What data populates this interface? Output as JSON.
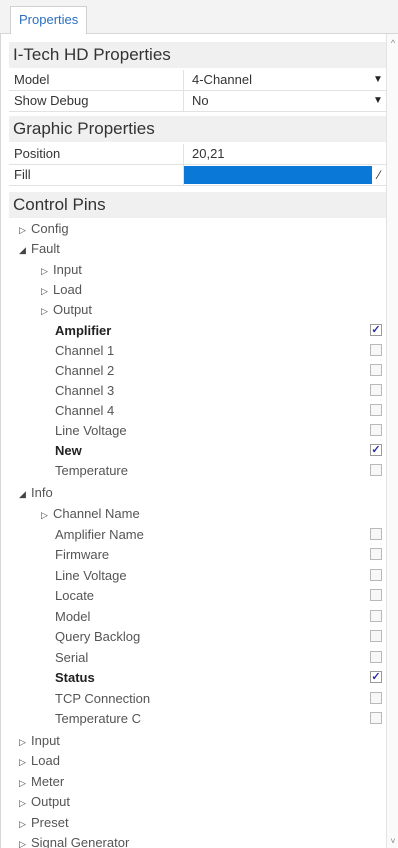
{
  "tab_label": "Properties",
  "section_ith": {
    "title": "I-Tech HD Properties"
  },
  "model_row": {
    "label": "Model",
    "value": "4-Channel"
  },
  "debug_row": {
    "label": "Show Debug",
    "value": "No"
  },
  "section_graphic": {
    "title": "Graphic Properties"
  },
  "position_row": {
    "label": "Position",
    "value": "20,21"
  },
  "fill_row": {
    "label": "Fill",
    "color": "#0a78d7"
  },
  "section_pins": {
    "title": "Control Pins"
  },
  "tree": {
    "config": "Config",
    "fault": "Fault",
    "fault_input": "Input",
    "fault_load": "Load",
    "fault_output": "Output",
    "amplifier": "Amplifier",
    "channel1": "Channel 1",
    "channel2": "Channel 2",
    "channel3": "Channel 3",
    "channel4": "Channel 4",
    "line_voltage_fault": "Line Voltage",
    "new": "New",
    "temperature": "Temperature",
    "info": "Info",
    "channel_name": "Channel Name",
    "amplifier_name": "Amplifier Name",
    "firmware": "Firmware",
    "line_voltage_info": "Line Voltage",
    "locate": "Locate",
    "model": "Model",
    "query_backlog": "Query Backlog",
    "serial": "Serial",
    "status": "Status",
    "tcp_connection": "TCP Connection",
    "temperature_c": "Temperature C",
    "input": "Input",
    "load": "Load",
    "meter": "Meter",
    "output": "Output",
    "preset": "Preset",
    "signal_generator": "Signal Generator"
  },
  "checks": {
    "amplifier": "✓",
    "new": "✓",
    "status": "✓"
  },
  "colors": {
    "accent": "#2a6fc2",
    "fill_swatch": "#0a78d7"
  }
}
